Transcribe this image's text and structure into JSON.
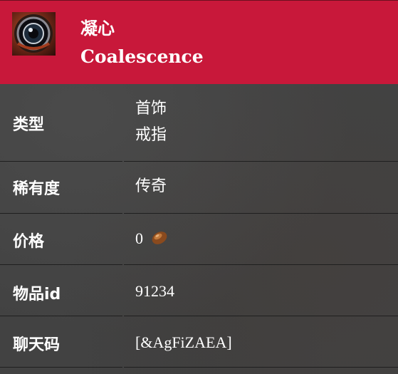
{
  "header": {
    "icon": "item-ring-icon",
    "name_zh": "凝心",
    "name_en": "Coalescence"
  },
  "rows": [
    {
      "label": "类型",
      "values": [
        "首饰",
        "戒指"
      ]
    },
    {
      "label": "稀有度",
      "value": "传奇"
    },
    {
      "label": "价格",
      "value": "0",
      "icon": "copper-coin-icon"
    },
    {
      "label": "物品id",
      "value": "91234"
    },
    {
      "label": "聊天码",
      "value": "[&AgFiZAEA]"
    }
  ],
  "colors": {
    "header_bg": "#c8183a",
    "body_bg": "#424242",
    "text": "#ffffff",
    "divider": "#1f1f1f"
  }
}
